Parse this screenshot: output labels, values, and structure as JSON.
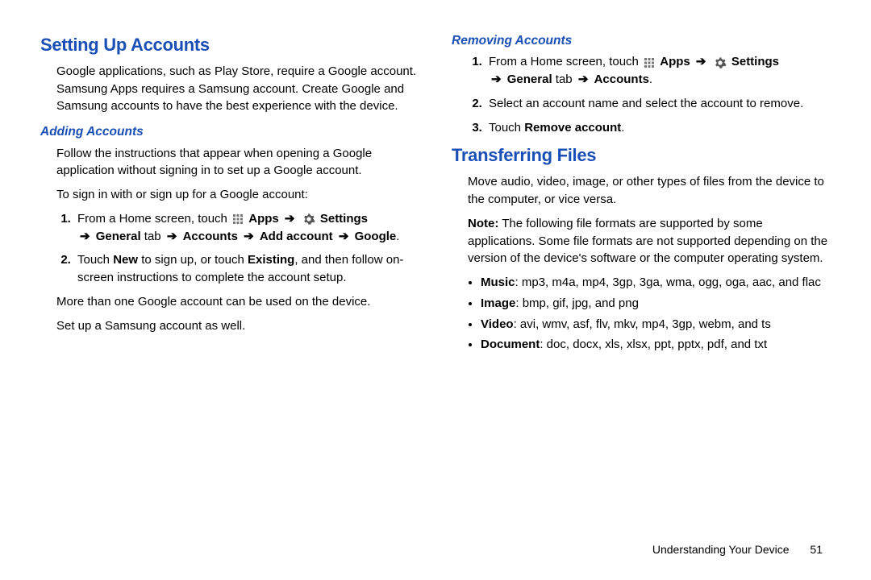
{
  "left": {
    "h1": "Setting Up Accounts",
    "intro": "Google applications, such as Play Store, require a Google account. Samsung Apps requires a Samsung account. Create Google and Samsung accounts to have the best experience with the device.",
    "adding_h2": "Adding Accounts",
    "adding_p1": "Follow the instructions that appear when opening a Google application without signing in to set up a Google account.",
    "adding_p2": "To sign in with or sign up for a Google account:",
    "step1_pre": "From a Home screen, touch",
    "apps": "Apps",
    "settings": "Settings",
    "general_tab": "General",
    "tab_word": " tab ",
    "accounts": "Accounts",
    "add_account": "Add account",
    "google": "Google",
    "step2_a": "Touch ",
    "new": "New",
    "step2_b": " to sign up, or touch ",
    "existing": "Existing",
    "step2_c": ", and then follow on-screen instructions to complete the account setup.",
    "after1": "More than one Google account can be used on the device.",
    "after2": "Set up a Samsung account as well."
  },
  "right": {
    "removing_h2": "Removing Accounts",
    "r1_pre": "From a Home screen, touch",
    "r2": "Select an account name and select the account to remove.",
    "r3_a": "Touch ",
    "r3_b": "Remove account",
    "h1b": "Transferring Files",
    "tf_p1": "Move audio, video, image, or other types of files from the device to the computer, or vice versa.",
    "note_label": "Note:",
    "note_body": " The following file formats are supported by some applications. Some file formats are not supported depending on the version of the device's software or the computer operating system.",
    "music_l": "Music",
    "music_v": ": mp3, m4a, mp4, 3gp, 3ga, wma, ogg, oga, aac, and flac",
    "image_l": "Image",
    "image_v": ": bmp, gif, jpg, and png",
    "video_l": "Video",
    "video_v": ": avi, wmv, asf, flv, mkv, mp4, 3gp, webm, and ts",
    "doc_l": "Document",
    "doc_v": ": doc, docx, xls, xlsx, ppt, pptx, pdf, and txt"
  },
  "footer": {
    "chapter": "Understanding Your Device",
    "page": "51"
  },
  "glyphs": {
    "arrow": "➔"
  }
}
